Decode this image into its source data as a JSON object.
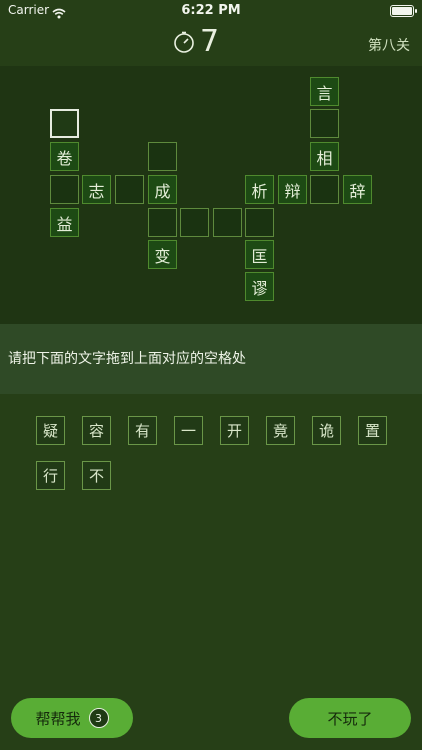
{
  "status_bar": {
    "carrier": "Carrier",
    "time": "6:22 PM"
  },
  "header": {
    "timer_value": "7",
    "level": "第八关"
  },
  "board": {
    "cells": [
      {
        "id": "c1",
        "text": "言",
        "filled": true
      },
      {
        "id": "c2",
        "text": "",
        "filled": false,
        "selected": true
      },
      {
        "id": "c3",
        "text": "",
        "filled": false
      },
      {
        "id": "c4",
        "text": "卷",
        "filled": true
      },
      {
        "id": "c5",
        "text": "",
        "filled": false
      },
      {
        "id": "c6",
        "text": "相",
        "filled": true
      },
      {
        "id": "c7",
        "text": "",
        "filled": false
      },
      {
        "id": "c8",
        "text": "志",
        "filled": true
      },
      {
        "id": "c9",
        "text": "",
        "filled": false
      },
      {
        "id": "c10",
        "text": "成",
        "filled": true
      },
      {
        "id": "c11",
        "text": "析",
        "filled": true
      },
      {
        "id": "c12",
        "text": "辩",
        "filled": true
      },
      {
        "id": "c13",
        "text": "",
        "filled": false
      },
      {
        "id": "c14",
        "text": "辞",
        "filled": true
      },
      {
        "id": "c15",
        "text": "益",
        "filled": true
      },
      {
        "id": "c16",
        "text": "",
        "filled": false
      },
      {
        "id": "c17",
        "text": "",
        "filled": false
      },
      {
        "id": "c18",
        "text": "",
        "filled": false
      },
      {
        "id": "c19",
        "text": "",
        "filled": false
      },
      {
        "id": "c20",
        "text": "变",
        "filled": true
      },
      {
        "id": "c21",
        "text": "匡",
        "filled": true
      },
      {
        "id": "c22",
        "text": "谬",
        "filled": true
      }
    ]
  },
  "instruction": "请把下面的文字拖到上面对应的空格处",
  "tiles": [
    "疑",
    "容",
    "有",
    "一",
    "开",
    "竟",
    "诡",
    "置",
    "行",
    "不"
  ],
  "buttons": {
    "help_label": "帮帮我",
    "help_count": "3",
    "quit_label": "不玩了"
  }
}
